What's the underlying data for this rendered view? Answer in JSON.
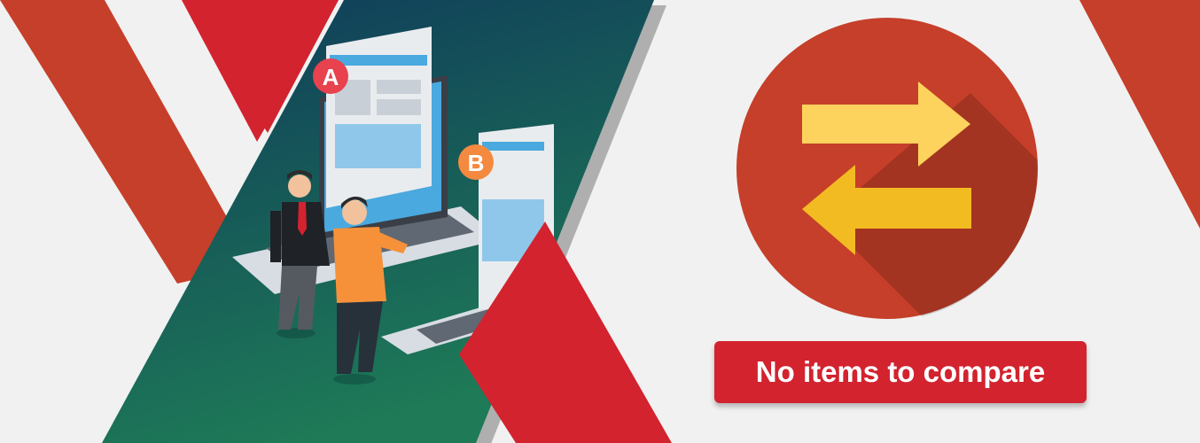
{
  "banner": {
    "compare_button_label": "No items to compare",
    "badge_a_label": "A",
    "badge_b_label": "B",
    "compare_icon": "compare-arrows-icon"
  },
  "colors": {
    "background": "#f1f1f1",
    "accent_red": "#d2232f",
    "accent_orange_red": "#c63f2a",
    "circle_red": "#c63f2a",
    "arrow_yellow": "#fdd25d",
    "arrow_gold": "#f3bb22",
    "teal_panel_top": "#0f3a5a",
    "teal_panel_bottom": "#1e7a57",
    "badge_a": "#e7424d",
    "badge_b": "#f48a3f",
    "button_red": "#d2232f"
  }
}
